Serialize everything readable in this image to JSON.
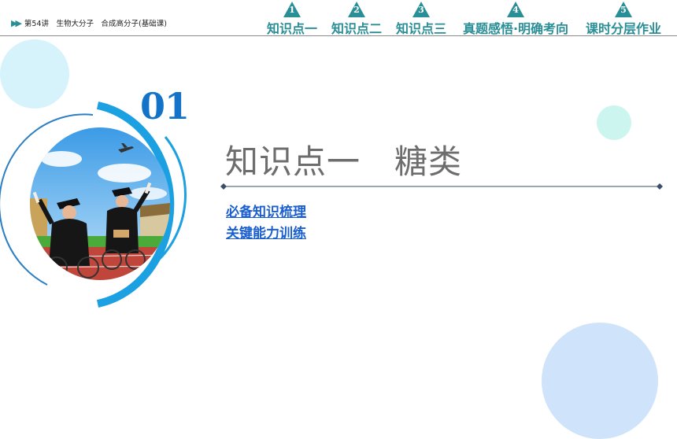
{
  "header": {
    "breadcrumb_arrows": "▶▶",
    "breadcrumb": "第54讲　生物大分子　合成高分子(基础课)",
    "tabs": [
      {
        "num": "1",
        "label": "知识点一"
      },
      {
        "num": "2",
        "label": "知识点二"
      },
      {
        "num": "3",
        "label": "知识点三"
      },
      {
        "num": "4",
        "label": "真题感悟·明确考向"
      },
      {
        "num": "5",
        "label": "课时分层作业"
      }
    ]
  },
  "section": {
    "number": "01",
    "title": "知识点一　糖类",
    "links": [
      "必备知识梳理",
      "关键能力训练"
    ]
  },
  "colors": {
    "accent_teal": "#2a8e96",
    "ring_blue": "#1ba0e2",
    "number_blue": "#1273c8",
    "link_blue": "#1a5fcf",
    "title_gray": "#6d6d6d"
  }
}
